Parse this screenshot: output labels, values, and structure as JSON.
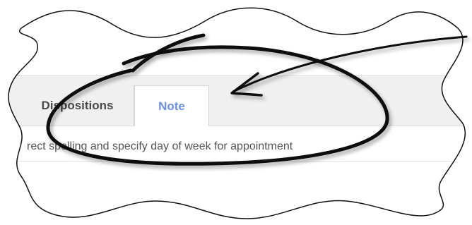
{
  "tabs": {
    "dispositions_label": "Dispositions",
    "note_label": "Note"
  },
  "note": {
    "text": "rect spelling and specify day of week for appointment"
  },
  "colors": {
    "active_tab": "#6d8fe0",
    "inactive_tab": "#4a4a4a",
    "tabbar_bg": "#f0f0f0"
  },
  "icons": {
    "annotation": "arrow-icon",
    "highlight": "circle-highlight-icon"
  }
}
